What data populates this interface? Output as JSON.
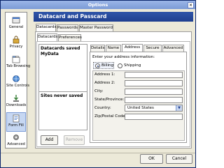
{
  "window": {
    "title": "Options",
    "close_glyph": "×"
  },
  "categories": [
    {
      "label": "General",
      "icon": "general-icon"
    },
    {
      "label": "Privacy",
      "icon": "privacy-icon"
    },
    {
      "label": "Tab Browsing",
      "icon": "tab-browsing-icon"
    },
    {
      "label": "Site Controls",
      "icon": "site-controls-icon"
    },
    {
      "label": "Downloads",
      "icon": "downloads-icon"
    },
    {
      "label": "Form Fill",
      "icon": "form-fill-icon",
      "selected": true
    },
    {
      "label": "Advanced",
      "icon": "advanced-icon"
    }
  ],
  "header": {
    "title": "Datacard and Passcard"
  },
  "top_tabs": [
    "Datacards",
    "Passwords",
    "Master Password"
  ],
  "sub_tabs": [
    "Datacards",
    "Preferences"
  ],
  "saved_list": {
    "title": "Datacards saved",
    "items": [
      "MyData"
    ]
  },
  "never_saved": {
    "title": "Sites never saved"
  },
  "buttons": {
    "add": "Add",
    "remove": "Remove",
    "ok": "OK",
    "cancel": "Cancel"
  },
  "detail_tabs": [
    "Details",
    "Name",
    "Address",
    "Secure",
    "Advanced"
  ],
  "address": {
    "prompt": "Enter your address information:",
    "billing": "Billing",
    "shipping": "Shipping",
    "fields": {
      "address1": "Address 1:",
      "address2": "Address 2:",
      "city": "City:",
      "state": "State/Province:",
      "country": "Country:",
      "zip": "Zip/Postal Code:"
    },
    "country_value": "United States",
    "dropdown_glyph": "▼"
  },
  "colors": {
    "header_bg": "#1f3f8f",
    "selected_category": "#c6d7f2"
  }
}
